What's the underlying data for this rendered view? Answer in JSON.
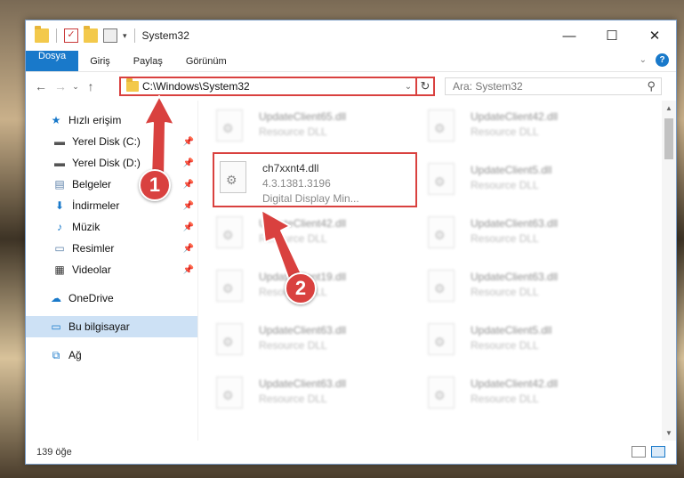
{
  "window": {
    "title": "System32",
    "controls": {
      "minimize": "—",
      "maximize": "☐",
      "close": "✕"
    }
  },
  "ribbon": {
    "tabs": [
      "Dosya",
      "Giriş",
      "Paylaş",
      "Görünüm"
    ],
    "colors": {
      "file_tab": "#1979ca"
    }
  },
  "nav": {
    "address_path": "C:\\Windows\\System32",
    "search_placeholder": "Ara: System32"
  },
  "sidebar": {
    "quick_access": "Hızlı erişim",
    "pinned": [
      "Yerel Disk (C:)",
      "Yerel Disk (D:)",
      "Belgeler",
      "İndirmeler",
      "Müzik",
      "Resimler",
      "Videolar"
    ],
    "onedrive": "OneDrive",
    "this_pc": "Bu bilgisayar",
    "network": "Ağ"
  },
  "files": [
    {
      "name": "UpdateClient65.dll",
      "sub": "Resource DLL",
      "blurred": true
    },
    {
      "name": "UpdateClient42.dll",
      "sub": "Resource DLL",
      "blurred": true
    },
    {
      "name": "ch7xxnt4.dll",
      "sub": "4.3.1381.3196",
      "sub2": "Digital Display Min...",
      "blurred": false
    },
    {
      "name": "UpdateClient5.dll",
      "sub": "Resource DLL",
      "blurred": true
    },
    {
      "name": "UpdateClient42.dll",
      "sub": "Resource DLL",
      "blurred": true
    },
    {
      "name": "UpdateClient63.dll",
      "sub": "Resource DLL",
      "blurred": true
    },
    {
      "name": "UpdateClient19.dll",
      "sub": "Resource DLL",
      "blurred": true
    },
    {
      "name": "UpdateClient63.dll",
      "sub": "Resource DLL",
      "blurred": true
    },
    {
      "name": "UpdateClient63.dll",
      "sub": "Resource DLL",
      "blurred": true
    },
    {
      "name": "UpdateClient5.dll",
      "sub": "Resource DLL",
      "blurred": true
    },
    {
      "name": "UpdateClient63.dll",
      "sub": "Resource DLL",
      "blurred": true
    },
    {
      "name": "UpdateClient42.dll",
      "sub": "Resource DLL",
      "blurred": true
    }
  ],
  "status": {
    "item_count": "139 öğe"
  },
  "callouts": {
    "step1": "1",
    "step2": "2",
    "color": "#d9413f"
  }
}
